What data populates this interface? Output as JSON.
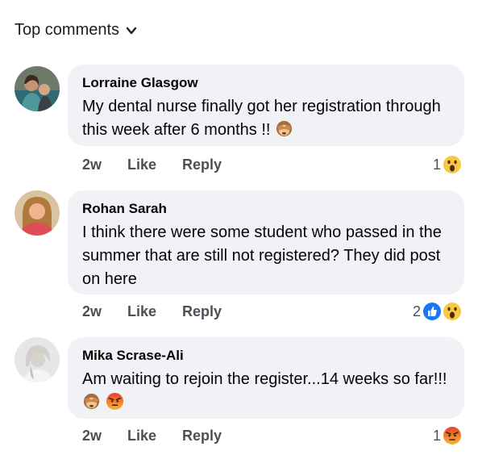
{
  "sort": {
    "label": "Top comments",
    "icon": "chevron-down-icon"
  },
  "comments": [
    {
      "author": "Lorraine Glasgow",
      "text": "My dental nurse finally got her registration through this week after 6 months !!",
      "emojis": [
        "see-no-evil-monkey-icon"
      ],
      "time": "2w",
      "like_label": "Like",
      "reply_label": "Reply",
      "reaction_count": "1",
      "reactions": [
        "wow-reaction-icon"
      ]
    },
    {
      "author": "Rohan Sarah",
      "text": "I think there were some student who passed in the summer that are still not registered? They did post on here",
      "emojis": [],
      "time": "2w",
      "like_label": "Like",
      "reply_label": "Reply",
      "reaction_count": "2",
      "reactions": [
        "like-reaction-icon",
        "wow-reaction-icon"
      ]
    },
    {
      "author": "Mika Scrase-Ali",
      "text": "Am waiting to rejoin the register...14 weeks so far!!!",
      "emojis": [
        "see-no-evil-monkey-icon",
        "angry-face-icon"
      ],
      "time": "2w",
      "like_label": "Like",
      "reply_label": "Reply",
      "reaction_count": "1",
      "reactions": [
        "angry-reaction-icon"
      ]
    }
  ]
}
